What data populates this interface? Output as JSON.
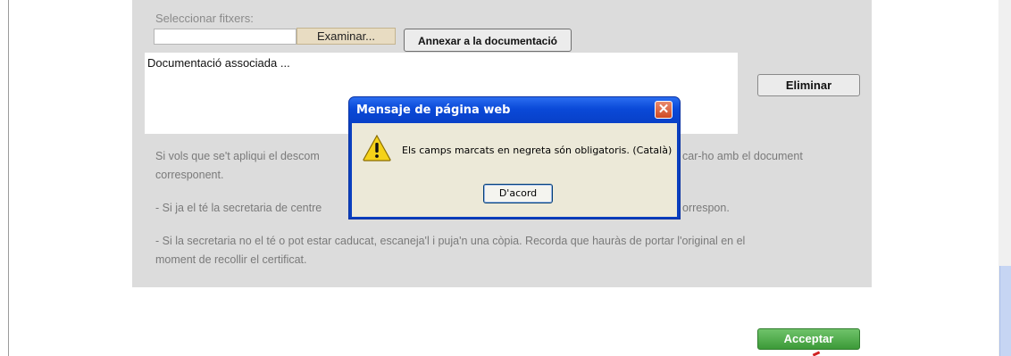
{
  "form": {
    "select_files_label": "Seleccionar fitxers:",
    "file_input_value": "",
    "browse_label": "Examinar...",
    "annex_label": "Annexar a la documentació",
    "associated_docs_text": "Documentació associada ...",
    "delete_label": "Eliminar",
    "accept_label": "Acceptar",
    "info": {
      "line1a": "Si vols que se't apliqui el descom",
      "line1b": "car-ho amb el document",
      "line2": "corresponent.",
      "line3a": "- Si ja el té la secretaria de centre",
      "line3b": "orrespon.",
      "line4": "- Si la secretaria no el té o pot estar caducat, escaneja'l i puja'n una còpia. Recorda que hauràs de portar l'original en el",
      "line5": "moment de recollir el certificat."
    }
  },
  "dialog": {
    "title": "Mensaje de página web",
    "close_glyph": "✕",
    "message": "Els camps marcats en negreta són obligatoris. (Català)",
    "ok_label": "D'acord",
    "icon": "warning-icon"
  },
  "colors": {
    "panel": "#dcdcdc",
    "accept": "#3c9a38",
    "dialog_title": "#0a49d8",
    "dialog_body": "#ece9d8"
  }
}
